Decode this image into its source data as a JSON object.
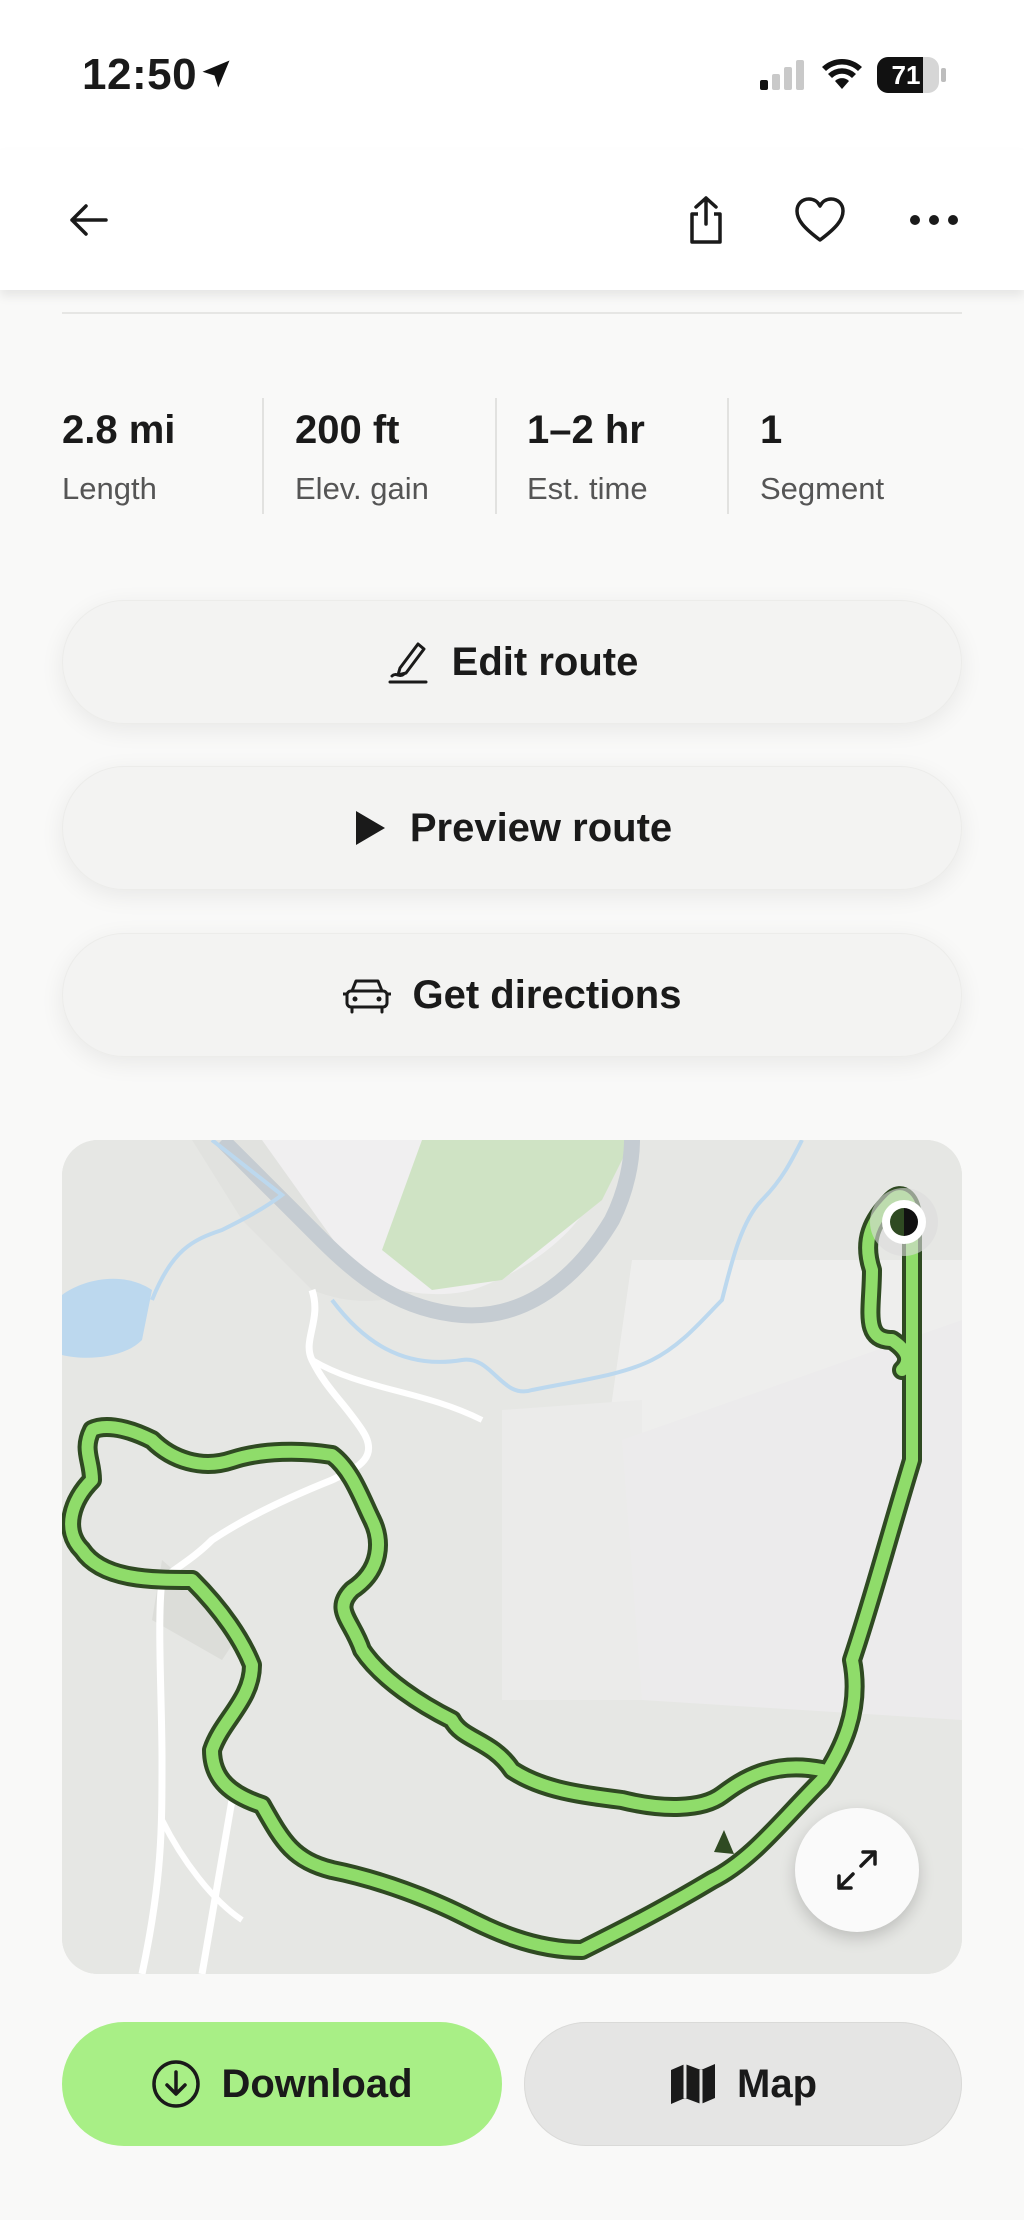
{
  "status_bar": {
    "time": "12:50",
    "battery": "71",
    "icons": [
      "location-arrow-icon",
      "cellular-signal-icon",
      "wifi-icon",
      "battery-icon"
    ]
  },
  "nav": {
    "icons": [
      "back-arrow-icon",
      "share-icon",
      "heart-icon",
      "more-dots-icon"
    ]
  },
  "stats": [
    {
      "value": "2.8 mi",
      "label": "Length"
    },
    {
      "value": "200 ft",
      "label": "Elev. gain"
    },
    {
      "value": "1–2 hr",
      "label": "Est. time"
    },
    {
      "value": "1",
      "label": "Segment"
    }
  ],
  "actions": {
    "edit_route": "Edit route",
    "preview_route": "Preview route",
    "get_directions": "Get directions"
  },
  "map": {
    "route_color": "#8fdc6a",
    "route_outline_color": "#2f4a22",
    "water_color": "#bcd8ee",
    "park_color": "#cfe3c4"
  },
  "bottom_actions": {
    "download": "Download",
    "map": "Map"
  },
  "colors": {
    "download_bg": "#a8ef86",
    "map_bg": "#e5e5e4",
    "button_bg": "#f3f3f2"
  }
}
